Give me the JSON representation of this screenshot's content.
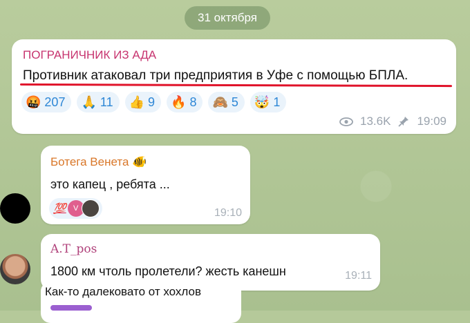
{
  "date_separator": "31 октября",
  "channel_post": {
    "channel_name": "ПОГРАНИЧНИК ИЗ АДА",
    "text": "Противник атаковал три предприятия в Уфе с помощью БПЛА.",
    "reactions": [
      {
        "emoji": "🤬",
        "count": "207"
      },
      {
        "emoji": "🙏",
        "count": "11"
      },
      {
        "emoji": "👍",
        "count": "9"
      },
      {
        "emoji": "🔥",
        "count": "8"
      },
      {
        "emoji": "🙈",
        "count": "5"
      },
      {
        "emoji": "🤯",
        "count": "1"
      }
    ],
    "views": "13.6K",
    "time": "19:09"
  },
  "messages": [
    {
      "author": "Ботега Венета 🐠",
      "text": "это капец , ребята ...",
      "reaction_emoji": "💯",
      "reactor_initial": "V",
      "time": "19:10"
    },
    {
      "author": "A.T_pos",
      "text": "1800 км чтоль пролетели? жесть канешн",
      "time": "19:11"
    },
    {
      "text": "Как-то далековато от хохлов"
    }
  ],
  "colors": {
    "channel_name": "#c7346f",
    "underline": "#e0132a",
    "reaction_count": "#2e87d6",
    "author1": "#d97729",
    "author2": "#b0427b"
  }
}
